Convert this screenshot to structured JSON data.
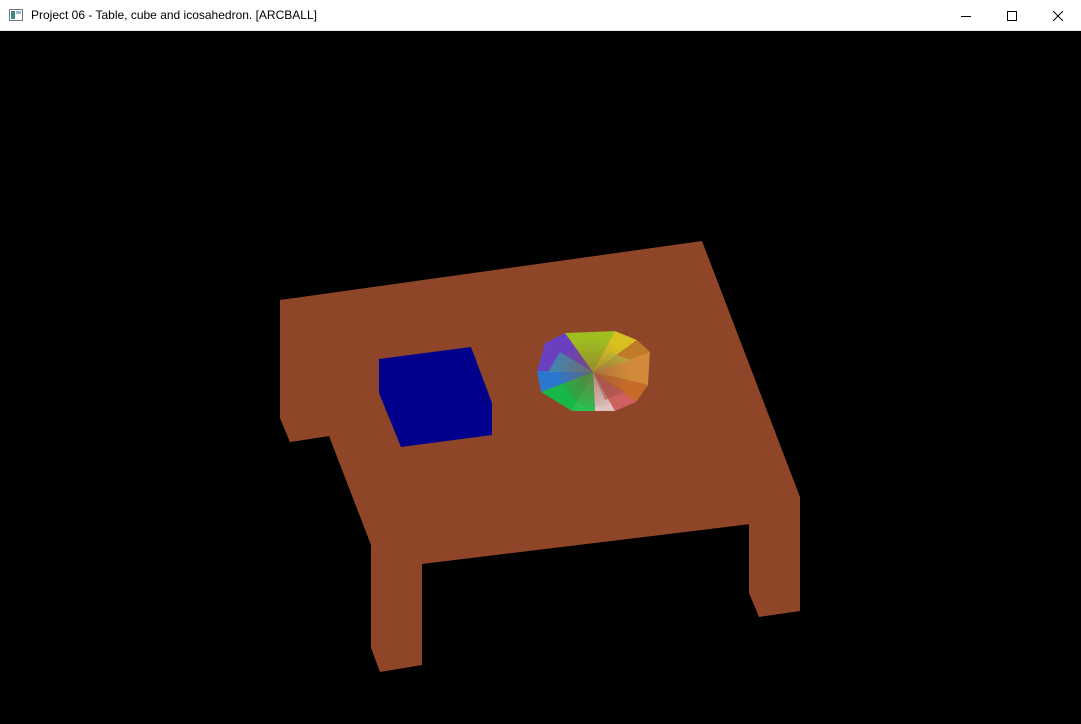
{
  "window": {
    "title": "Project 06 - Table, cube and icosahedron. [ARCBALL]",
    "app_icon": "window-app-icon",
    "controls": {
      "minimize_icon": "minimize-icon",
      "maximize_icon": "maximize-icon",
      "close_icon": "close-icon"
    }
  },
  "scene": {
    "background_color": "#000000",
    "objects": [
      {
        "name": "table",
        "color": "#8f4628"
      },
      {
        "name": "cube",
        "color": "#00008c"
      },
      {
        "name": "icosahedron",
        "coloring": "per-vertex rainbow"
      }
    ]
  }
}
